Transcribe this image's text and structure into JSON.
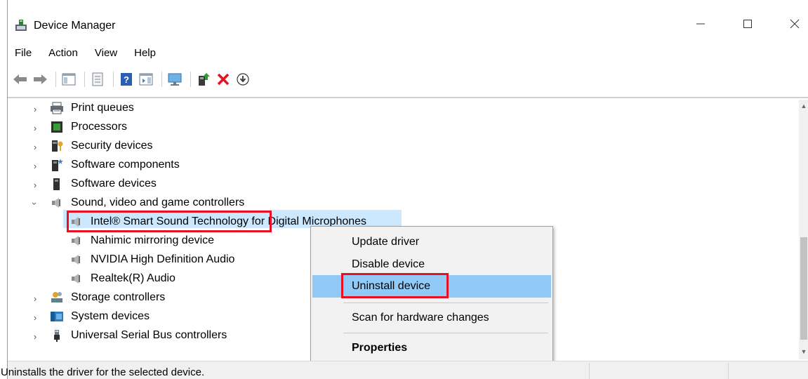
{
  "window": {
    "title": "Device Manager",
    "minimize_glyph": "—",
    "maximize_glyph": "☐",
    "close_glyph": "✕"
  },
  "menu": [
    "File",
    "Action",
    "View",
    "Help"
  ],
  "toolbar": {
    "buttons": [
      "back-arrow-icon",
      "forward-arrow-icon",
      "show-hide-console-tree-icon",
      "properties-icon",
      "help-icon",
      "action-pane-icon",
      "monitor-icon",
      "update-driver-icon",
      "uninstall-icon",
      "install-icon"
    ]
  },
  "tree": {
    "items": [
      {
        "label": "Print queues",
        "expanded": false,
        "icon": "printer-icon"
      },
      {
        "label": "Processors",
        "expanded": false,
        "icon": "processor-icon"
      },
      {
        "label": "Security devices",
        "expanded": false,
        "icon": "security-device-icon"
      },
      {
        "label": "Software components",
        "expanded": false,
        "icon": "software-component-icon"
      },
      {
        "label": "Software devices",
        "expanded": false,
        "icon": "software-device-icon"
      },
      {
        "label": "Sound, video and game controllers",
        "expanded": true,
        "icon": "speaker-icon"
      },
      {
        "label": "Storage controllers",
        "expanded": false,
        "icon": "storage-icon"
      },
      {
        "label": "System devices",
        "expanded": false,
        "icon": "system-device-icon"
      },
      {
        "label": "Universal Serial Bus controllers",
        "expanded": false,
        "icon": "usb-icon"
      }
    ],
    "sound_children": [
      {
        "label": "Intel® Smart Sound Technology for Digital Microphones",
        "selected": true
      },
      {
        "label": "Nahimic mirroring device",
        "selected": false
      },
      {
        "label": "NVIDIA High Definition Audio",
        "selected": false
      },
      {
        "label": "Realtek(R) Audio",
        "selected": false
      }
    ]
  },
  "context_menu": {
    "items": [
      {
        "label": "Update driver",
        "highlighted": false,
        "bold": false
      },
      {
        "label": "Disable device",
        "highlighted": false,
        "bold": false
      },
      {
        "label": "Uninstall device",
        "highlighted": true,
        "bold": false
      },
      {
        "label": "Scan for hardware changes",
        "highlighted": false,
        "bold": false
      },
      {
        "label": "Properties",
        "highlighted": false,
        "bold": true
      }
    ]
  },
  "status": {
    "text": "Uninstalls the driver for the selected device."
  },
  "colors": {
    "selection": "#cce8ff",
    "menu_highlight": "#91c9f7",
    "annotation_red": "#e81123",
    "delete_red": "#e81123"
  }
}
